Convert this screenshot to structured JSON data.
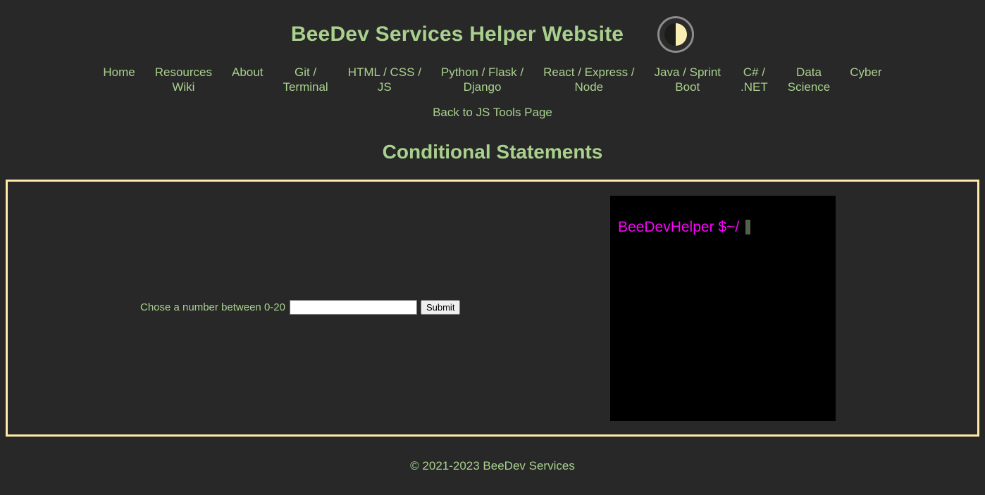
{
  "header": {
    "site_title": "BeeDev Services Helper Website",
    "theme_toggle_label": "dark-light-mode-toggle",
    "nav_items": [
      {
        "label": "Home"
      },
      {
        "label": "Resources\nWiki"
      },
      {
        "label": "About"
      },
      {
        "label": "Git /\nTerminal"
      },
      {
        "label": "HTML / CSS /\nJS"
      },
      {
        "label": "Python / Flask /\nDjango"
      },
      {
        "label": "React / Express /\nNode"
      },
      {
        "label": "Java / Sprint\nBoot"
      },
      {
        "label": "C# /\n.NET"
      },
      {
        "label": "Data\nScience"
      },
      {
        "label": "Cyber"
      }
    ],
    "subnav_label": "Back to JS Tools Page"
  },
  "main": {
    "page_heading": "Conditional Statements",
    "form": {
      "label": "Chose a number between 0-20",
      "input_value": "",
      "input_placeholder": "",
      "submit_label": "Submit"
    },
    "terminal": {
      "prompt": "BeeDevHelper $~/",
      "output": ""
    }
  },
  "footer": {
    "copyright": "© 2021-2023 BeeDev Services"
  },
  "colors": {
    "background": "#282828",
    "accent_text": "#a9d18e",
    "panel_border": "#ffeaa7",
    "terminal_background": "#000000",
    "terminal_prompt": "#ff00ff",
    "terminal_cursor": "#55604a"
  }
}
